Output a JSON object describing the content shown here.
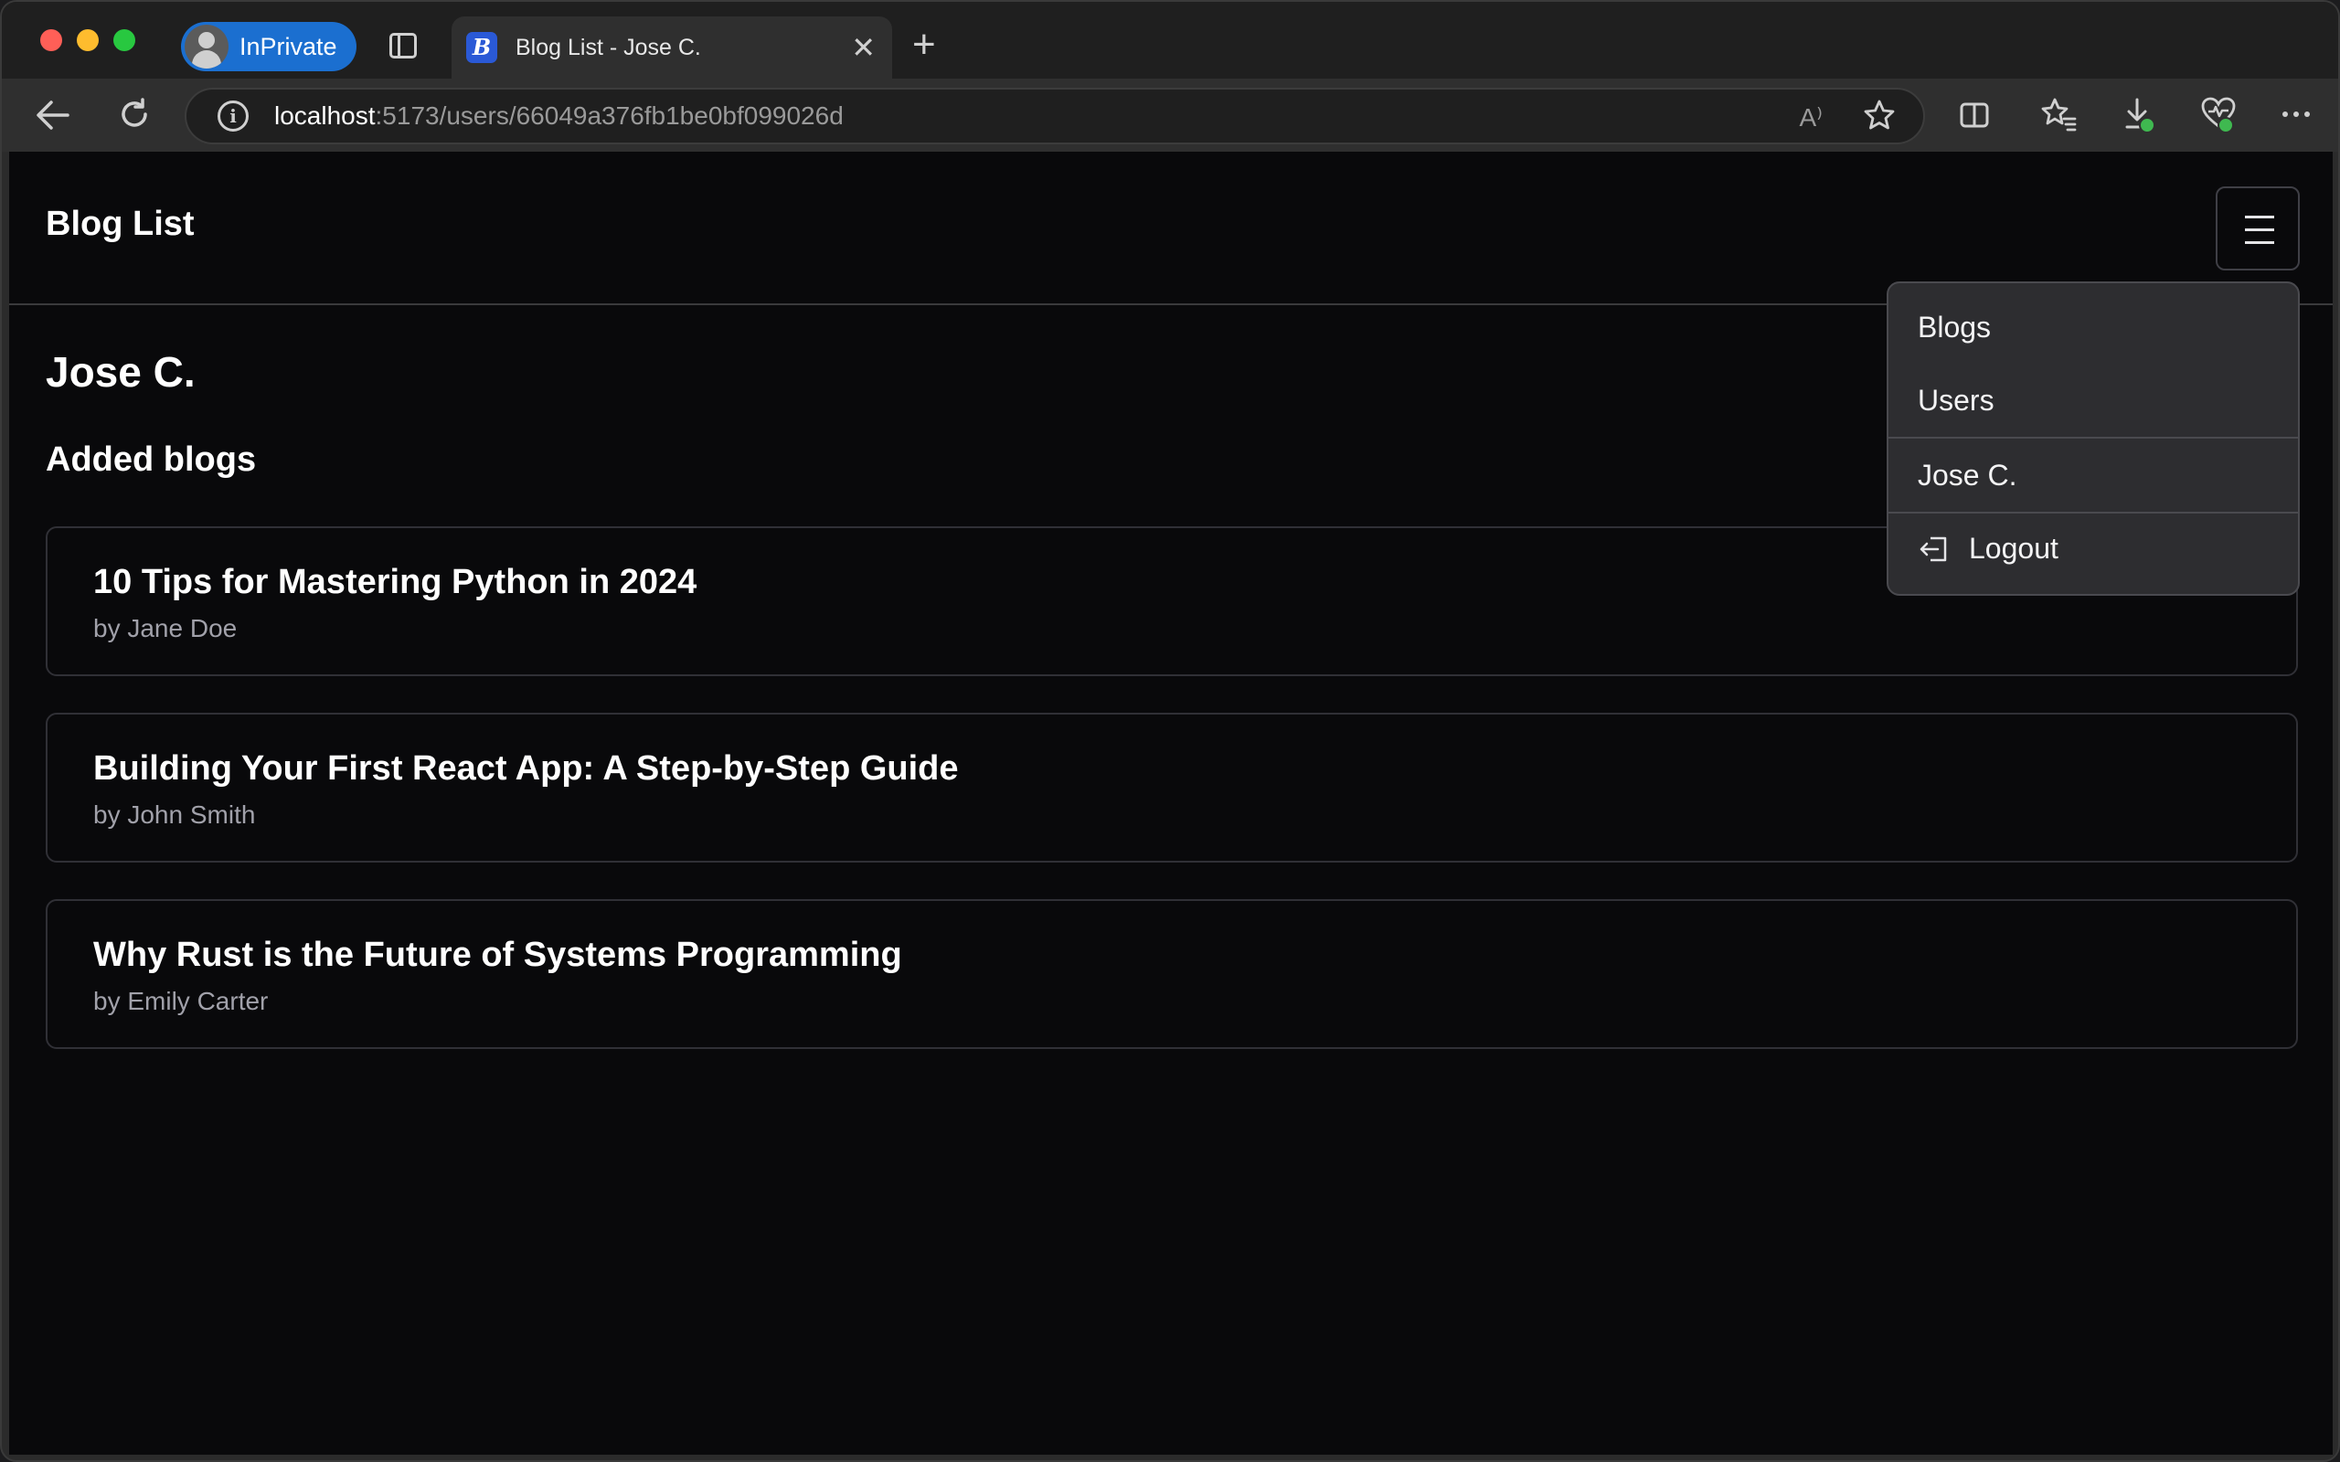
{
  "browser": {
    "profile_label": "InPrivate",
    "tab_title": "Blog List - Jose C.",
    "tab_favicon": "B",
    "tab_close": "✕",
    "new_tab": "+",
    "url_host": "localhost",
    "url_rest": ":5173/users/66049a376fb1be0bf099026d",
    "read_aloud": "A⁾",
    "icons": [
      "back-icon",
      "refresh-icon",
      "info-icon",
      "read-aloud-icon",
      "favorite-star-icon",
      "split-screen-icon",
      "favorites-icon",
      "downloads-icon",
      "browser-essentials-icon",
      "more-icon"
    ]
  },
  "app": {
    "brand": "Blog List",
    "user_name": "Jose C.",
    "section_title": "Added blogs",
    "blogs": [
      {
        "title": "10 Tips for Mastering Python in 2024",
        "author": "by Jane Doe"
      },
      {
        "title": "Building Your First React App: A Step-by-Step Guide",
        "author": "by John Smith"
      },
      {
        "title": "Why Rust is the Future of Systems Programming",
        "author": "by Emily Carter"
      }
    ],
    "menu": {
      "blogs": "Blogs",
      "users": "Users",
      "user": "Jose C.",
      "logout": "Logout"
    }
  },
  "colors": {
    "page_bg": "#09090b",
    "accent": "#1b6fd0",
    "border": "#303036",
    "muted_text": "#a1a1aa"
  }
}
